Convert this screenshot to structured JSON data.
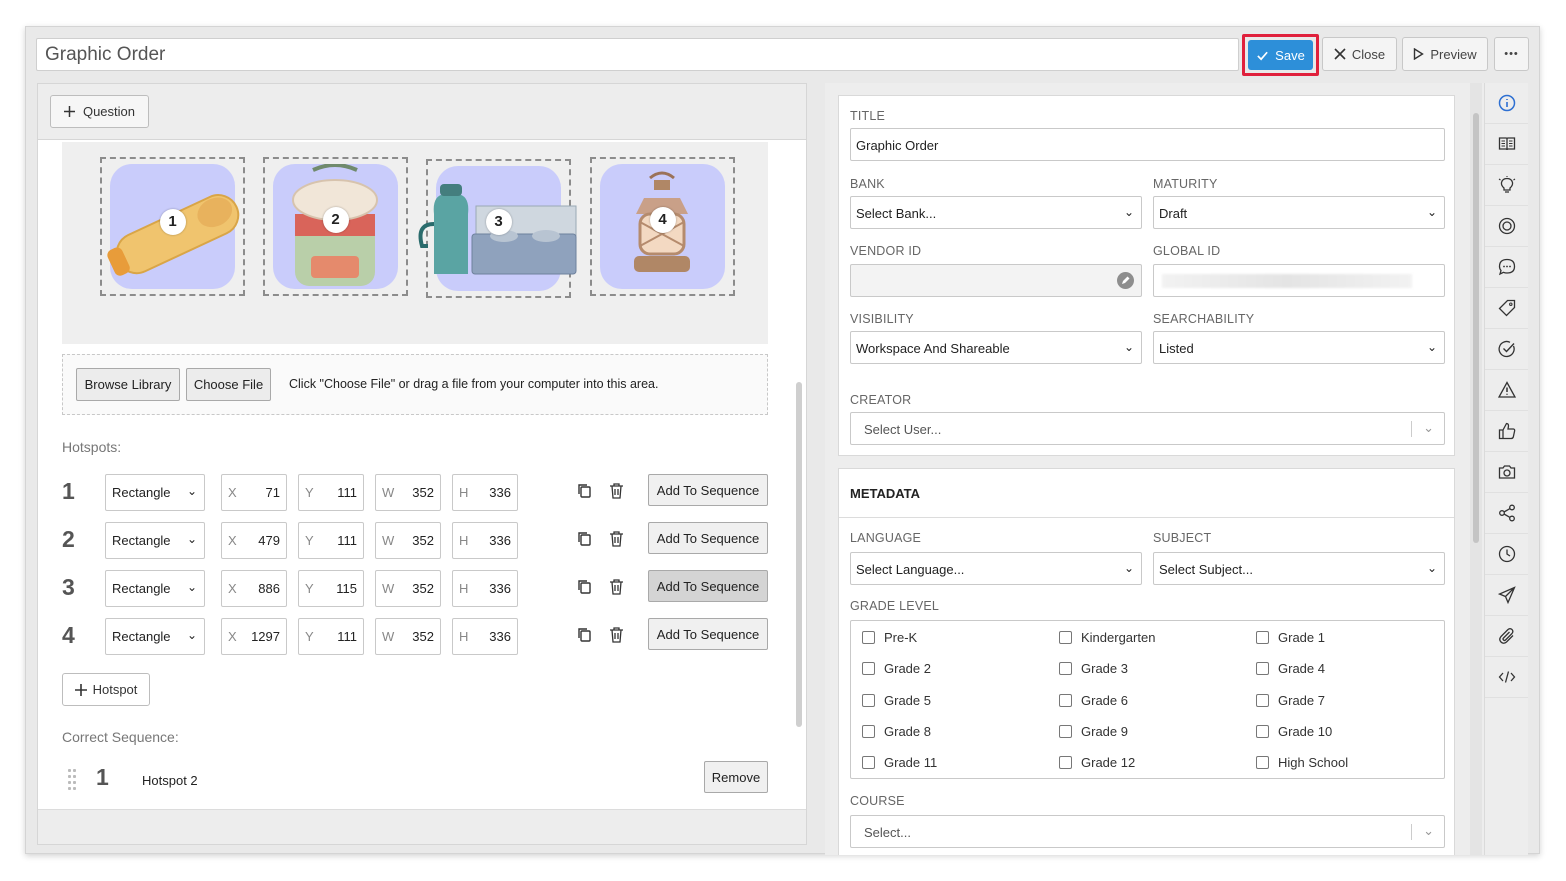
{
  "header": {
    "title_value": "Graphic Order",
    "save_label": "Save",
    "close_label": "Close",
    "preview_label": "Preview",
    "more_label": "•••"
  },
  "left": {
    "add_question_label": "Question",
    "hotspot_images": [
      {
        "num": "1",
        "icon": "sleeping-bag-icon"
      },
      {
        "num": "2",
        "icon": "backpack-icon"
      },
      {
        "num": "3",
        "icon": "camp-stove-icon"
      },
      {
        "num": "4",
        "icon": "lantern-icon"
      }
    ],
    "upload": {
      "browse_label": "Browse Library",
      "choose_label": "Choose File",
      "hint": "Click \"Choose File\" or drag a file from your computer into this area."
    },
    "hotspots_heading": "Hotspots:",
    "hotspot_rows": [
      {
        "num": "1",
        "shape": "Rectangle",
        "x": "71",
        "y": "111",
        "w": "352",
        "h": "336",
        "seq_label": "Add To Sequence"
      },
      {
        "num": "2",
        "shape": "Rectangle",
        "x": "479",
        "y": "111",
        "w": "352",
        "h": "336",
        "seq_label": "Add To Sequence"
      },
      {
        "num": "3",
        "shape": "Rectangle",
        "x": "886",
        "y": "115",
        "w": "352",
        "h": "336",
        "seq_label": "Add To Sequence"
      },
      {
        "num": "4",
        "shape": "Rectangle",
        "x": "1297",
        "y": "111",
        "w": "352",
        "h": "336",
        "seq_label": "Add To Sequence"
      }
    ],
    "field_letters": {
      "x": "X",
      "y": "Y",
      "w": "W",
      "h": "H"
    },
    "add_hotspot_label": "Hotspot",
    "correct_sequence_heading": "Correct Sequence:",
    "sequence": [
      {
        "num": "1",
        "label": "Hotspot 2",
        "remove_label": "Remove"
      }
    ]
  },
  "right": {
    "title_label": "TITLE",
    "title_value": "Graphic Order",
    "bank_label": "BANK",
    "bank_value": "Select Bank...",
    "maturity_label": "MATURITY",
    "maturity_value": "Draft",
    "vendor_label": "VENDOR ID",
    "vendor_value": "",
    "global_label": "GLOBAL ID",
    "visibility_label": "VISIBILITY",
    "visibility_value": "Workspace And Shareable",
    "searchability_label": "SEARCHABILITY",
    "searchability_value": "Listed",
    "creator_label": "CREATOR",
    "creator_placeholder": "Select User...",
    "metadata_heading": "METADATA",
    "language_label": "LANGUAGE",
    "language_value": "Select Language...",
    "subject_label": "SUBJECT",
    "subject_value": "Select Subject...",
    "grade_label": "GRADE LEVEL",
    "grades": [
      "Pre-K",
      "Kindergarten",
      "Grade 1",
      "Grade 2",
      "Grade 3",
      "Grade 4",
      "Grade 5",
      "Grade 6",
      "Grade 7",
      "Grade 8",
      "Grade 9",
      "Grade 10",
      "Grade 11",
      "Grade 12",
      "High School"
    ],
    "course_label": "COURSE",
    "course_placeholder": "Select..."
  },
  "rail_icons": [
    "info-icon",
    "book-icon",
    "lightbulb-icon",
    "target-icon",
    "comment-icon",
    "tag-icon",
    "check-circle-icon",
    "warning-icon",
    "thumbs-up-icon",
    "camera-icon",
    "share-icon",
    "clock-icon",
    "send-icon",
    "paperclip-icon",
    "code-icon"
  ],
  "colors": {
    "save": "#2d8fd9",
    "highlight": "#e0203c",
    "image_bg": "#c9ccfb"
  }
}
